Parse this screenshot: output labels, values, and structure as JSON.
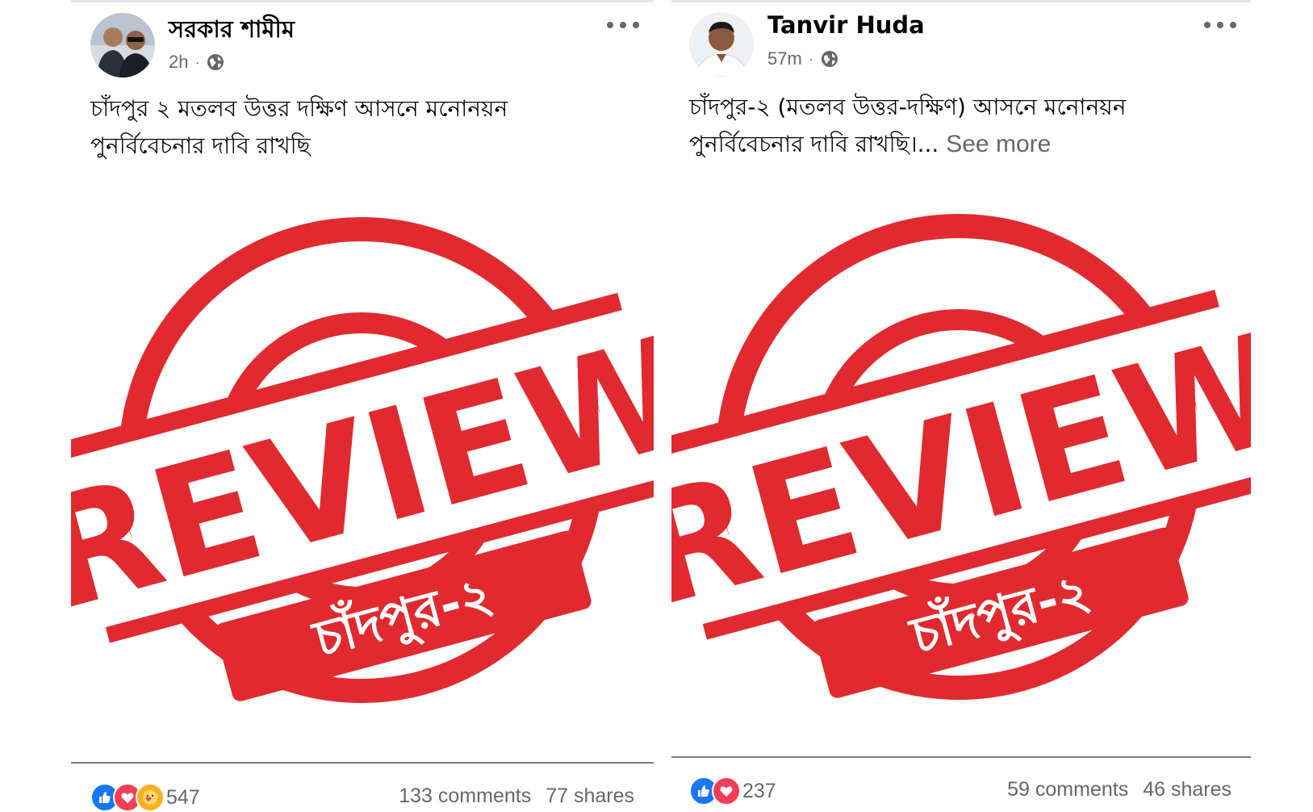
{
  "posts": [
    {
      "author": "সরকার শামীম",
      "time": "2h",
      "separator": "·",
      "text_line1": "চাঁদপুর ২ মতলব উত্তর দক্ষিণ আসনে মনোনয়ন",
      "text_line2": "পুনর্বিবেচনার দাবি রাখছি",
      "see_more": "",
      "stamp_word": "REVIEW",
      "stamp_banner": "চাঁদপুর-২",
      "reaction_count": "547",
      "comments": "133 comments",
      "shares": "77 shares",
      "reactions": [
        "like-icon",
        "love-icon",
        "care-icon"
      ]
    },
    {
      "author": "Tanvir Huda",
      "time": "57m",
      "separator": "·",
      "text_line1": "চাঁদপুর-২ (মতলব উত্তর-দক্ষিণ) আসনে মনোনয়ন",
      "text_line2": "পুনর্বিবেচনার দাবি রাখছি।...",
      "see_more": "See more",
      "stamp_word": "REVIEW",
      "stamp_banner": "চাঁদপুর-২",
      "reaction_count": "237",
      "comments": "59 comments",
      "shares": "46 shares",
      "reactions": [
        "like-icon",
        "love-icon"
      ]
    }
  ],
  "colors": {
    "stamp_red": "#e02a2f",
    "meta_gray": "#65676b",
    "like_blue": "#1877f2",
    "love_red": "#f33e58"
  }
}
